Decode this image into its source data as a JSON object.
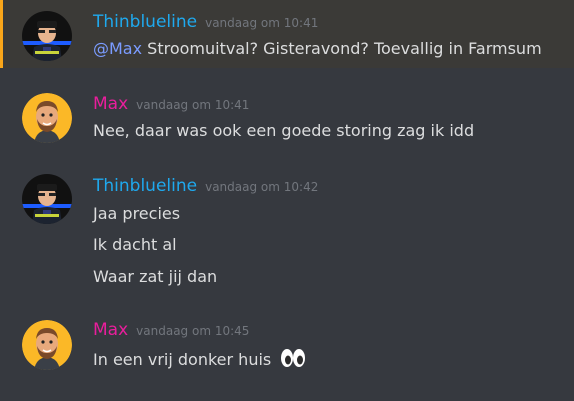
{
  "messages": [
    {
      "author": "Thinblueline",
      "timestamp": "vandaag om 10:41",
      "mention": "@Max",
      "lines": [
        "Stroomuitval? Gisteravond? Toevallig in Farmsum"
      ]
    },
    {
      "author": "Max",
      "timestamp": "vandaag om 10:41",
      "lines": [
        "Nee, daar was ook een goede storing zag ik idd"
      ]
    },
    {
      "author": "Thinblueline",
      "timestamp": "vandaag om 10:42",
      "lines": [
        "Jaa precies",
        "Ik dacht al",
        "Waar zat jij dan"
      ]
    },
    {
      "author": "Max",
      "timestamp": "vandaag om 10:45",
      "lines": [
        "In een vrij donker huis"
      ],
      "emoji": "eyes-icon"
    }
  ],
  "colors": {
    "background": "#36393f",
    "highlight_bar": "#faa61a",
    "thinblueline_name": "#1fa9ee",
    "max_name": "#e91e9c",
    "mention": "#7b9cff",
    "text": "#dcddde",
    "timestamp": "#72767d"
  }
}
